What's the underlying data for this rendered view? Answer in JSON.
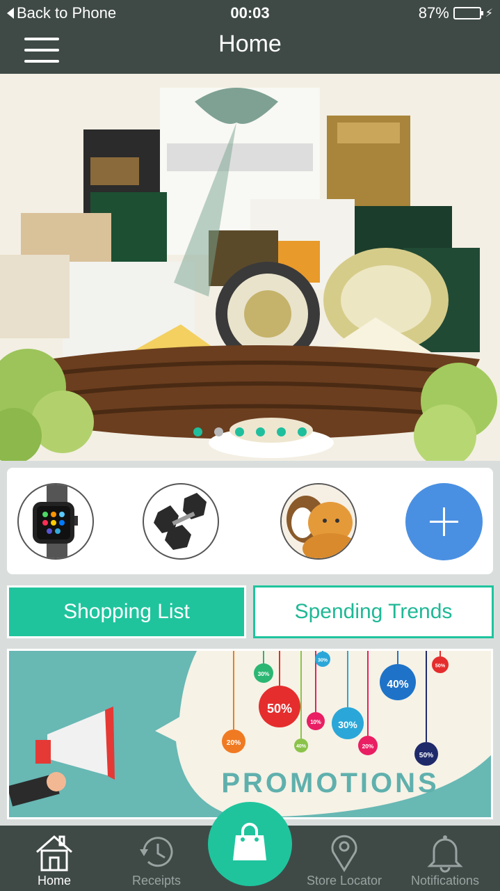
{
  "status_bar": {
    "back_label": "Back to Phone",
    "time": "00:03",
    "battery": "87%"
  },
  "nav": {
    "title": "Home"
  },
  "hero": {
    "slide_count": 6,
    "active_slide": 2
  },
  "categories": {
    "items": [
      {
        "name": "smartwatch"
      },
      {
        "name": "dumbbells"
      },
      {
        "name": "pets"
      }
    ]
  },
  "buttons": {
    "shopping_list": "Shopping List",
    "spending_trends": "Spending Trends"
  },
  "promo": {
    "title": "PROMOTIONS",
    "badges": [
      "50%",
      "40%",
      "30%",
      "20%",
      "30%",
      "50%",
      "10%",
      "20%",
      "30%",
      "50%",
      "40%"
    ]
  },
  "tabs": [
    {
      "label": "Home",
      "icon": "home-icon",
      "active": true
    },
    {
      "label": "Receipts",
      "icon": "history-icon",
      "active": false
    },
    {
      "label": "",
      "icon": "shopping-bag-icon",
      "active": false
    },
    {
      "label": "Store Locator",
      "icon": "location-pin-icon",
      "active": false
    },
    {
      "label": "Notifications",
      "icon": "bell-icon",
      "active": false
    }
  ],
  "colors": {
    "accent": "#1fc49d",
    "bar": "#3f4a47",
    "add_button": "#4a90e2"
  }
}
